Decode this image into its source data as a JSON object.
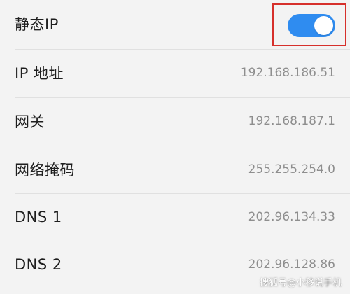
{
  "settings": {
    "static_ip": {
      "label": "静态IP",
      "enabled": true
    },
    "rows": [
      {
        "label": "IP 地址",
        "value": "192.168.186.51"
      },
      {
        "label": "网关",
        "value": "192.168.187.1"
      },
      {
        "label": "网络掩码",
        "value": "255.255.254.0"
      },
      {
        "label": "DNS 1",
        "value": "202.96.134.33"
      },
      {
        "label": "DNS 2",
        "value": "202.96.128.86"
      }
    ]
  },
  "watermark": "搜狐号@小移说手机",
  "colors": {
    "toggle_on": "#2f8cf0",
    "highlight_border": "#d6302b",
    "background": "#f3f3f3",
    "label_text": "#1e1e1e",
    "value_text": "#8e8e8e"
  }
}
